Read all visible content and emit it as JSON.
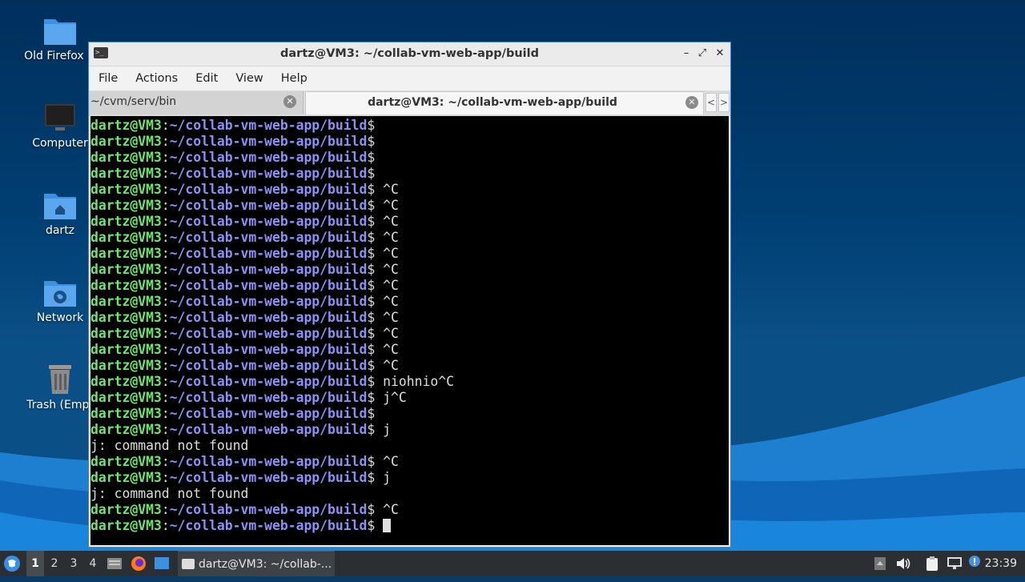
{
  "desktop": {
    "icons": [
      {
        "label": "Old Firefox D",
        "icon": "folder-icon"
      },
      {
        "label": "Computer",
        "icon": "computer-icon"
      },
      {
        "label": "dartz",
        "icon": "home-folder-icon"
      },
      {
        "label": "Network",
        "icon": "network-folder-icon"
      },
      {
        "label": "Trash (Empt",
        "icon": "trash-icon"
      }
    ]
  },
  "window": {
    "title": "dartz@VM3: ~/collab-vm-web-app/build",
    "controls": {
      "minimize": "–",
      "maximize": "⤢",
      "close": "✕"
    },
    "menu": [
      "File",
      "Actions",
      "Edit",
      "View",
      "Help"
    ],
    "tabs": [
      {
        "label": "~/cvm/serv/bin",
        "active": false
      },
      {
        "label": "dartz@VM3: ~/collab-vm-web-app/build",
        "active": true
      }
    ],
    "tab_scroll": {
      "left": "<",
      "right": ">"
    }
  },
  "terminal": {
    "prompt": {
      "user": "dartz@VM3",
      "colon": ":",
      "path": "~/collab-vm-web-app/build",
      "dollar": "$"
    },
    "lines": [
      {
        "type": "prompt",
        "cmd": ""
      },
      {
        "type": "prompt",
        "cmd": ""
      },
      {
        "type": "prompt",
        "cmd": ""
      },
      {
        "type": "prompt",
        "cmd": ""
      },
      {
        "type": "prompt",
        "cmd": " ^C"
      },
      {
        "type": "prompt",
        "cmd": " ^C"
      },
      {
        "type": "prompt",
        "cmd": " ^C"
      },
      {
        "type": "prompt",
        "cmd": " ^C"
      },
      {
        "type": "prompt",
        "cmd": " ^C"
      },
      {
        "type": "prompt",
        "cmd": " ^C"
      },
      {
        "type": "prompt",
        "cmd": " ^C"
      },
      {
        "type": "prompt",
        "cmd": " ^C"
      },
      {
        "type": "prompt",
        "cmd": " ^C"
      },
      {
        "type": "prompt",
        "cmd": " ^C"
      },
      {
        "type": "prompt",
        "cmd": " ^C"
      },
      {
        "type": "prompt",
        "cmd": " ^C"
      },
      {
        "type": "prompt",
        "cmd": " niohnio^C"
      },
      {
        "type": "prompt",
        "cmd": " j^C"
      },
      {
        "type": "prompt",
        "cmd": ""
      },
      {
        "type": "prompt",
        "cmd": " j"
      },
      {
        "type": "output",
        "text": "j: command not found"
      },
      {
        "type": "prompt",
        "cmd": " ^C"
      },
      {
        "type": "prompt",
        "cmd": " j"
      },
      {
        "type": "output",
        "text": "j: command not found"
      },
      {
        "type": "prompt",
        "cmd": " ^C"
      },
      {
        "type": "prompt",
        "cmd": " ",
        "cursor": true
      }
    ]
  },
  "taskbar": {
    "workspaces": [
      "1",
      "2",
      "3",
      "4"
    ],
    "active_workspace": "1",
    "task_label": "dartz@VM3: ~/collab-...",
    "clock": "23:39"
  },
  "colors": {
    "prompt_user": "#6ee56e",
    "prompt_path": "#8f8ff5",
    "terminal_bg": "#000000",
    "taskbar_bg": "#2b2f33",
    "window_border": "#4b85c7"
  }
}
